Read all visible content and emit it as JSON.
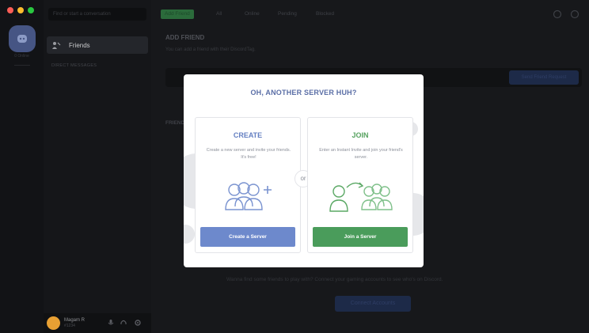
{
  "window": {
    "controls": [
      "close",
      "minimize",
      "zoom"
    ]
  },
  "server_rail": {
    "home_icon": "discord-logo-icon",
    "online_count": "0 Online"
  },
  "sidebar": {
    "search_placeholder": "Find or start a conversation",
    "friends_label": "Friends",
    "dm_header": "DIRECT MESSAGES"
  },
  "user_panel": {
    "name": "Magam R",
    "tag": "#1234"
  },
  "topbar": {
    "tabs": [
      "Add Friend",
      "All",
      "Online",
      "Pending",
      "Blocked"
    ]
  },
  "add_friend": {
    "title": "ADD FRIEND",
    "description": "You can add a friend with their DiscordTag.",
    "send_button": "Send Friend Request"
  },
  "friends_section": {
    "label": "FRIENDS"
  },
  "bottom": {
    "text": "Wanna find some friends to play with? Connect your gaming accounts to see who's on Discord.",
    "connect_button": "Connect Accounts"
  },
  "modal": {
    "title": "OH, ANOTHER SERVER HUH?",
    "or_label": "or",
    "create": {
      "title": "CREATE",
      "description": "Create a new server and invite your friends. It's free!",
      "button": "Create a Server",
      "color": "#6d89cc"
    },
    "join": {
      "title": "JOIN",
      "description": "Enter an Instant Invite and join your friend's server.",
      "button": "Join a Server",
      "color": "#4a9c5b"
    }
  }
}
